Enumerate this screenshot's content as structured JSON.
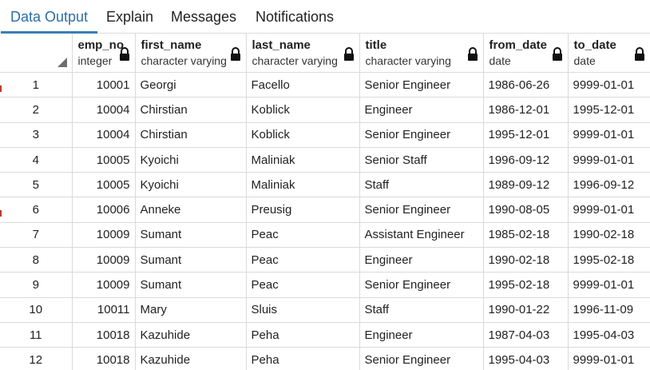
{
  "tabs": [
    {
      "label": "Data Output"
    },
    {
      "label": "Explain"
    },
    {
      "label": "Messages"
    },
    {
      "label": "Notifications"
    }
  ],
  "columns": [
    {
      "name": "emp_no",
      "name_display": "emp_no",
      "type": "integer"
    },
    {
      "name": "first_name",
      "name_display": "first_name",
      "type": "character varying"
    },
    {
      "name": "last_name",
      "name_display": "last_name",
      "type": "character varying"
    },
    {
      "name": "title",
      "name_display": "title",
      "type": "character varying"
    },
    {
      "name": "from_date",
      "name_display": "from_date",
      "type": "date"
    },
    {
      "name": "to_date",
      "name_display": "to_date",
      "type": "date"
    }
  ],
  "rows": [
    {
      "n": "1",
      "emp_no": "10001",
      "first_name": "Georgi",
      "last_name": "Facello",
      "title": "Senior Engineer",
      "from_date": "1986-06-26",
      "to_date": "9999-01-01"
    },
    {
      "n": "2",
      "emp_no": "10004",
      "first_name": "Chirstian",
      "last_name": "Koblick",
      "title": "Engineer",
      "from_date": "1986-12-01",
      "to_date": "1995-12-01"
    },
    {
      "n": "3",
      "emp_no": "10004",
      "first_name": "Chirstian",
      "last_name": "Koblick",
      "title": "Senior Engineer",
      "from_date": "1995-12-01",
      "to_date": "9999-01-01"
    },
    {
      "n": "4",
      "emp_no": "10005",
      "first_name": "Kyoichi",
      "last_name": "Maliniak",
      "title": "Senior Staff",
      "from_date": "1996-09-12",
      "to_date": "9999-01-01"
    },
    {
      "n": "5",
      "emp_no": "10005",
      "first_name": "Kyoichi",
      "last_name": "Maliniak",
      "title": "Staff",
      "from_date": "1989-09-12",
      "to_date": "1996-09-12"
    },
    {
      "n": "6",
      "emp_no": "10006",
      "first_name": "Anneke",
      "last_name": "Preusig",
      "title": "Senior Engineer",
      "from_date": "1990-08-05",
      "to_date": "9999-01-01"
    },
    {
      "n": "7",
      "emp_no": "10009",
      "first_name": "Sumant",
      "last_name": "Peac",
      "title": "Assistant Engineer",
      "from_date": "1985-02-18",
      "to_date": "1990-02-18"
    },
    {
      "n": "8",
      "emp_no": "10009",
      "first_name": "Sumant",
      "last_name": "Peac",
      "title": "Engineer",
      "from_date": "1990-02-18",
      "to_date": "1995-02-18"
    },
    {
      "n": "9",
      "emp_no": "10009",
      "first_name": "Sumant",
      "last_name": "Peac",
      "title": "Senior Engineer",
      "from_date": "1995-02-18",
      "to_date": "9999-01-01"
    },
    {
      "n": "10",
      "emp_no": "10011",
      "first_name": "Mary",
      "last_name": "Sluis",
      "title": "Staff",
      "from_date": "1990-01-22",
      "to_date": "1996-11-09"
    },
    {
      "n": "11",
      "emp_no": "10018",
      "first_name": "Kazuhide",
      "last_name": "Peha",
      "title": "Engineer",
      "from_date": "1987-04-03",
      "to_date": "1995-04-03"
    },
    {
      "n": "12",
      "emp_no": "10018",
      "first_name": "Kazuhide",
      "last_name": "Peha",
      "title": "Senior Engineer",
      "from_date": "1995-04-03",
      "to_date": "9999-01-01"
    }
  ]
}
